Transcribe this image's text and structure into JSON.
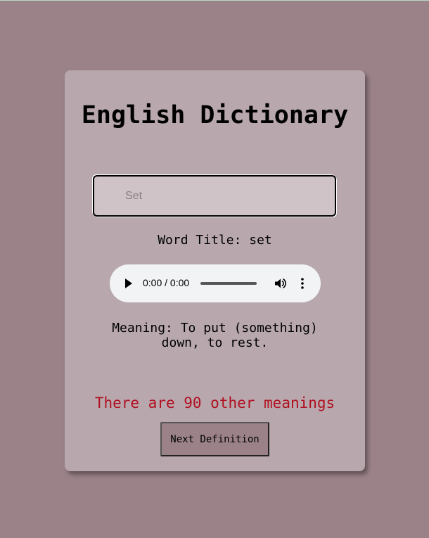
{
  "app": {
    "title": "English Dictionary"
  },
  "search": {
    "value": "Set",
    "placeholder": ""
  },
  "result": {
    "word_title": "Word Title: set",
    "meaning": "Meaning: To put (something) down, to rest.",
    "other_meanings": "There are 90 other meanings"
  },
  "audio": {
    "time": "0:00 / 0:00",
    "progress": 0,
    "play_icon": "play-icon",
    "volume_icon": "volume-icon",
    "more_icon": "more-options-icon"
  },
  "buttons": {
    "next_label": "Next Definition"
  },
  "colors": {
    "background": "#9a8288",
    "card": "#b8a8ad",
    "input": "#cfc3c7",
    "other_meanings": "#b01020"
  }
}
